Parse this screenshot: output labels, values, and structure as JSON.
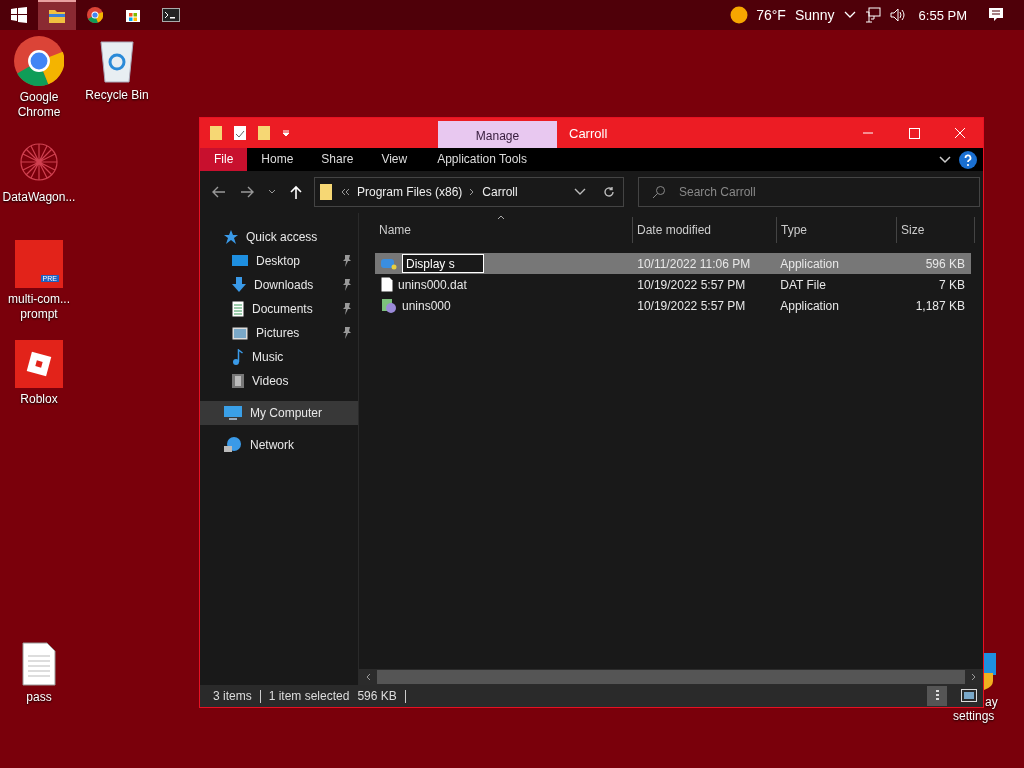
{
  "taskbar": {
    "apps": [
      {
        "kind": "explorer",
        "selected": true
      },
      {
        "kind": "chrome",
        "selected": false
      },
      {
        "kind": "store",
        "selected": false
      },
      {
        "kind": "terminal",
        "selected": false
      }
    ],
    "temperature": "76°F",
    "weather": "Sunny",
    "time": "6:55 PM"
  },
  "desktop_icons": [
    {
      "kind": "chrome",
      "label": "Google Chrome"
    },
    {
      "kind": "recycle",
      "label": "Recycle Bin"
    },
    {
      "kind": "datawagon",
      "label": "DataWagon..."
    },
    {
      "kind": "prompt",
      "label": "multi-com... prompt",
      "badge": "PRE"
    },
    {
      "kind": "roblox",
      "label": "Roblox"
    },
    {
      "kind": "file",
      "label": "pass"
    },
    {
      "kind": "settings",
      "label_lines": [
        "ay",
        "settings"
      ]
    }
  ],
  "window": {
    "title": "Carroll",
    "context_tab": "Manage",
    "ribbon_tabs": [
      {
        "label": "File",
        "selected": true
      },
      {
        "label": "Home",
        "selected": false
      },
      {
        "label": "Share",
        "selected": false
      },
      {
        "label": "View",
        "selected": false
      },
      {
        "label": "Application Tools",
        "selected": false
      }
    ],
    "breadcrumb": [
      "Program Files (x86)",
      "Carroll"
    ],
    "search": {
      "placeholder": "Search Carroll"
    },
    "nav": [
      {
        "kind": "star",
        "label": "Quick access",
        "selected": false,
        "children": [
          {
            "kind": "desktop",
            "label": "Desktop",
            "pinned": true,
            "selected": false
          },
          {
            "kind": "download",
            "label": "Downloads",
            "pinned": true,
            "selected": false
          },
          {
            "kind": "document",
            "label": "Documents",
            "pinned": true,
            "selected": false
          },
          {
            "kind": "picture",
            "label": "Pictures",
            "pinned": true,
            "selected": false
          },
          {
            "kind": "music",
            "label": "Music",
            "pinned": false,
            "selected": false
          },
          {
            "kind": "video",
            "label": "Videos",
            "pinned": false,
            "selected": false
          }
        ]
      },
      {
        "kind": "computer",
        "label": "My Computer",
        "selected": true
      },
      {
        "kind": "network",
        "label": "Network",
        "selected": false
      }
    ],
    "columns": [
      "Name",
      "Date modified",
      "Type",
      "Size"
    ],
    "rows": [
      {
        "kind": "app",
        "name": "Display s",
        "editing": true,
        "selected": true,
        "date": "10/11/2022 11:06 PM",
        "type": "Application",
        "size": "596 KB"
      },
      {
        "kind": "dat",
        "name": "unins000.dat",
        "editing": false,
        "selected": false,
        "date": "10/19/2022 5:57 PM",
        "type": "DAT File",
        "size": "7 KB"
      },
      {
        "kind": "setup",
        "name": "unins000",
        "editing": false,
        "selected": false,
        "date": "10/19/2022 5:57 PM",
        "type": "Application",
        "size": "1,187 KB"
      }
    ],
    "status": {
      "count": "3 items",
      "selection": "1 item selected",
      "size": "596 KB"
    }
  }
}
